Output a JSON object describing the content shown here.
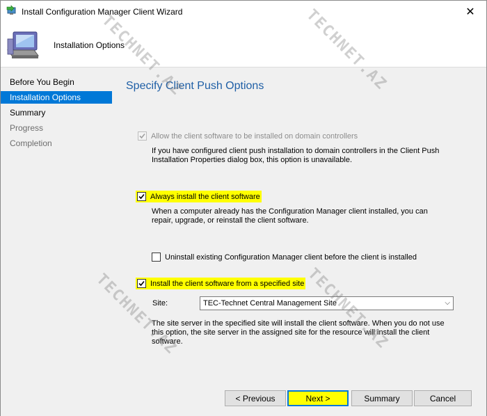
{
  "window": {
    "title": "Install Configuration Manager Client Wizard",
    "close_glyph": "✕"
  },
  "header": {
    "title": "Installation Options"
  },
  "sidebar": {
    "items": [
      {
        "label": "Before You Begin",
        "state": "normal"
      },
      {
        "label": "Installation Options",
        "state": "active"
      },
      {
        "label": "Summary",
        "state": "normal"
      },
      {
        "label": "Progress",
        "state": "disabled"
      },
      {
        "label": "Completion",
        "state": "disabled"
      }
    ]
  },
  "main": {
    "heading": "Specify Client Push Options",
    "options": {
      "domain_controllers": {
        "label": "Allow the client software to be installed on domain controllers",
        "checked": true,
        "enabled": false,
        "description": "If you have configured client push installation to domain controllers in the Client Push Installation Properties dialog box, this option is unavailable."
      },
      "always_install": {
        "label": "Always install the client software",
        "checked": true,
        "enabled": true,
        "description": "When a computer already has the Configuration Manager client installed, you can repair, upgrade, or reinstall the client software."
      },
      "uninstall_existing": {
        "label": "Uninstall existing Configuration Manager client before the client is installed",
        "checked": false,
        "enabled": true
      },
      "specified_site": {
        "label": "Install the client software from a specified site",
        "checked": true,
        "enabled": true,
        "site_label": "Site:",
        "site_value": "TEC-Technet Central Management Site",
        "description": "The site server in the specified site will install the client software.  When you do not use this option, the site server in the assigned site for the resource will install the client software."
      }
    }
  },
  "footer": {
    "previous_label": "< Previous",
    "next_label": "Next >",
    "summary_label": "Summary",
    "cancel_label": "Cancel"
  },
  "watermark": {
    "text": "TECHNET.AZ"
  },
  "colors": {
    "accent": "#0078d7",
    "heading": "#1f5fa6",
    "highlight": "#ffff00"
  }
}
